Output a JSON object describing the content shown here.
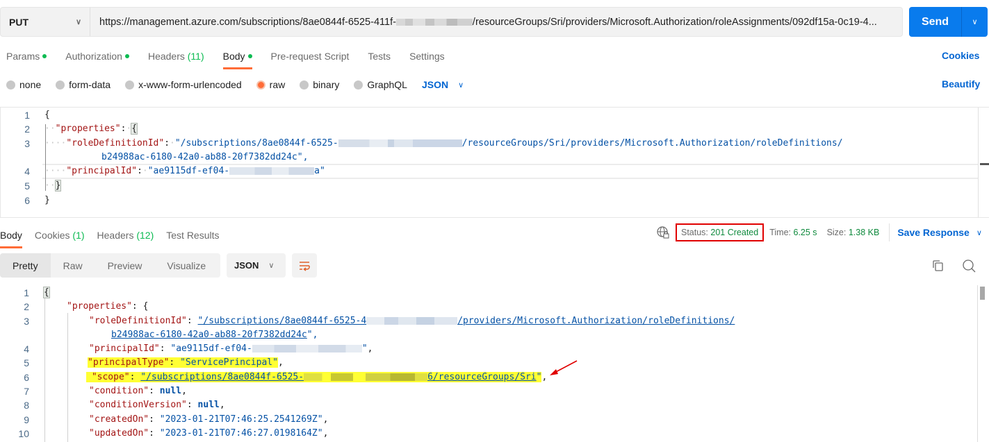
{
  "request": {
    "method": "PUT",
    "url_prefix": "https://management.azure.com/subscriptions/8ae0844f-6525-411f-",
    "url_suffix": "/resourceGroups/Sri/providers/Microsoft.Authorization/roleAssignments/092df15a-0c19-4...",
    "send_label": "Send"
  },
  "request_tabs": [
    {
      "label": "Params",
      "dot": true
    },
    {
      "label": "Authorization",
      "dot": true
    },
    {
      "label": "Headers",
      "count": "(11)"
    },
    {
      "label": "Body",
      "dot": true,
      "active": true
    },
    {
      "label": "Pre-request Script"
    },
    {
      "label": "Tests"
    },
    {
      "label": "Settings"
    }
  ],
  "cookies_label": "Cookies",
  "beautify_label": "Beautify",
  "body_types": [
    {
      "label": "none",
      "selected": false
    },
    {
      "label": "form-data",
      "selected": false
    },
    {
      "label": "x-www-form-urlencoded",
      "selected": false
    },
    {
      "label": "raw",
      "selected": true
    },
    {
      "label": "binary",
      "selected": false
    },
    {
      "label": "GraphQL",
      "selected": false
    }
  ],
  "body_format": "JSON",
  "request_body": {
    "line_numbers": [
      "1",
      "2",
      "3",
      "",
      "4",
      "5",
      "6"
    ],
    "l1": "{",
    "l2_key": "\"properties\"",
    "l2_brace": "{",
    "l3_key": "\"roleDefinitionId\"",
    "l3_val_a": "\"/subscriptions/8ae0844f-6525-",
    "l3_val_b": "/resourceGroups/Sri/providers/Microsoft.Authorization/roleDefinitions/",
    "l3_wrap": "b24988ac-6180-42a0-ab88-20f7382dd24c\",",
    "l4_key": "\"principalId\"",
    "l4_val_a": "\"ae9115df-ef04-",
    "l4_val_b": "a\"",
    "l5": "}",
    "l6": "}"
  },
  "response_tabs": [
    {
      "label": "Body",
      "active": true
    },
    {
      "label": "Cookies",
      "count": "(1)"
    },
    {
      "label": "Headers",
      "count": "(12)"
    },
    {
      "label": "Test Results"
    }
  ],
  "response_status": {
    "status_label": "Status:",
    "status_value": "201 Created",
    "time_label": "Time:",
    "time_value": "6.25 s",
    "size_label": "Size:",
    "size_value": "1.38 KB",
    "save_label": "Save Response"
  },
  "view_modes": [
    "Pretty",
    "Raw",
    "Preview",
    "Visualize"
  ],
  "response_format": "JSON",
  "response_body": {
    "line_numbers": [
      "1",
      "2",
      "3",
      "",
      "4",
      "5",
      "6",
      "7",
      "8",
      "9",
      "10"
    ],
    "l1": "{",
    "l2_key": "\"properties\"",
    "l2_brace": "{",
    "l3_key": "\"roleDefinitionId\"",
    "l3_val_a": "\"/subscriptions/8ae0844f-6525-4",
    "l3_val_b": "/providers/Microsoft.Authorization/roleDefinitions/",
    "l3_wrap": "b24988ac-6180-42a0-ab88-20f7382dd24c",
    "l4_key": "\"principalId\"",
    "l4_val_a": "\"ae9115df-ef04-",
    "l4_val_b": "\"",
    "l5_key": "\"principalType\"",
    "l5_val": "\"ServicePrincipal\"",
    "l6_key": "\"scope\"",
    "l6_val_a": "\"/subscriptions/8ae0844f-6525-",
    "l6_val_b": "6/resourceGroups/Sri",
    "l7_key": "\"condition\"",
    "l7_val": "null",
    "l8_key": "\"conditionVersion\"",
    "l8_val": "null",
    "l9_key": "\"createdOn\"",
    "l9_val": "\"2023-01-21T07:46:25.2541269Z\"",
    "l10_key": "\"updatedOn\"",
    "l10_val": "\"2023-01-21T07:46:27.0198164Z\""
  },
  "colors": {
    "accent_orange": "#ff6c37",
    "send_blue": "#097bed",
    "link_blue": "#0265d2",
    "status_green": "#0f8a3d",
    "highlight_yellow": "#ffff33",
    "annotation_red": "#e00000"
  }
}
